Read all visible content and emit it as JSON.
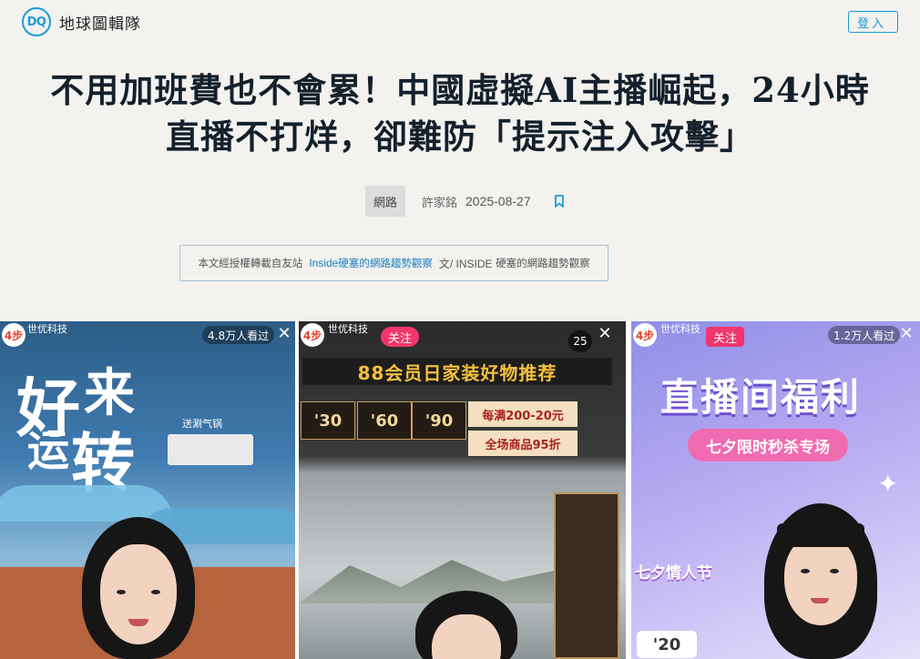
{
  "site": {
    "logo_text": "DQ",
    "name": "地球圖輯隊",
    "login_label": "登入"
  },
  "article": {
    "title_line1": "不用加班費也不會累！中國虛擬AI主播崛起，24小時",
    "title_line2": "直播不打烊，卻難防「提示注入攻擊」",
    "tag": "網路",
    "author": "許家銘",
    "date": "2025-08-27",
    "source": {
      "prefix": "本文經授權轉載自友站",
      "link_en": "Inside",
      "link_zh": "硬塞的網路趨勢觀察",
      "suffix_en": "文/ INSIDE",
      "suffix_zh": "硬塞的網路趨勢觀察"
    }
  },
  "hero": {
    "panel1": {
      "badge": "4步",
      "store": "世优科技",
      "viewers": "4.8万人看过",
      "slogan1": "好",
      "slogan2": "来",
      "slogan3": "运",
      "slogan4": "转",
      "product": "送涮气锅"
    },
    "panel2": {
      "badge": "4步",
      "store": "世优科技",
      "follow": "关注",
      "count": "25",
      "banner": "88会员日家装好物推荐",
      "prices": [
        "'30",
        "'60",
        "'90"
      ],
      "coupon1": "每满200-20元",
      "coupon2": "全场商品95折"
    },
    "panel3": {
      "badge": "4步",
      "store": "世优科技",
      "follow": "关注",
      "viewers": "1.2万人看过",
      "title": "直播间福利",
      "subtitle": "七夕限时秒杀专场",
      "festival": "七夕情人节",
      "price": "'20"
    },
    "close_glyph": "✕",
    "colors": {
      "accent": "#1a9bd7",
      "follow_pink": "#f2356b"
    }
  }
}
